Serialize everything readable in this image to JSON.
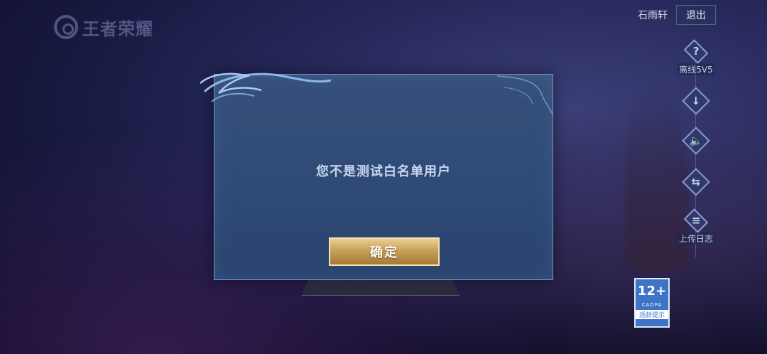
{
  "header": {
    "logo_text": "王者荣耀",
    "username": "石雨轩",
    "logout_label": "退出"
  },
  "sidebar": {
    "items": [
      {
        "icon": "question-icon",
        "glyph": "?",
        "label": "离线5V5"
      },
      {
        "icon": "download-icon",
        "glyph": "↓",
        "label": ""
      },
      {
        "icon": "speaker-icon",
        "glyph": "🔈",
        "label": ""
      },
      {
        "icon": "switch-account-icon",
        "glyph": "⇆",
        "label": ""
      },
      {
        "icon": "upload-log-icon",
        "glyph": "≡",
        "label": "上传日志"
      }
    ]
  },
  "age_rating": {
    "age": "12+",
    "org": "CADPA",
    "tip": "适龄提示"
  },
  "dialog": {
    "message": "您不是测试白名单用户",
    "confirm_label": "确定"
  },
  "colors": {
    "dialog_bg": "#2f4a76",
    "dialog_border": "#6f95c6",
    "button_gold": "#c9a158",
    "cadpa_blue": "#3d74c7"
  }
}
